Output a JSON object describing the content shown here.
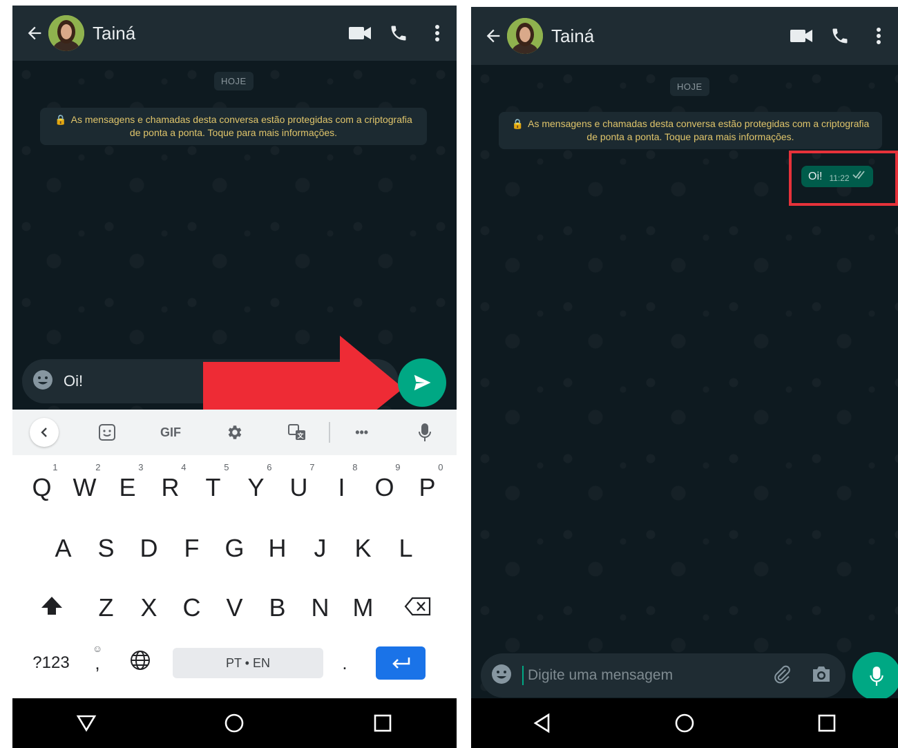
{
  "contact_name": "Tainá",
  "date_chip": "HOJE",
  "encryption_notice": "As mensagens e chamadas desta conversa estão protegidas com a criptografia de ponta a ponta. Toque para mais informações.",
  "left": {
    "typed_message": "Oi!",
    "keyboard": {
      "toolbar_gif": "GIF",
      "toolbar_more": "•••",
      "row1": [
        {
          "key": "Q",
          "num": "1"
        },
        {
          "key": "W",
          "num": "2"
        },
        {
          "key": "E",
          "num": "3"
        },
        {
          "key": "R",
          "num": "4"
        },
        {
          "key": "T",
          "num": "5"
        },
        {
          "key": "Y",
          "num": "6"
        },
        {
          "key": "U",
          "num": "7"
        },
        {
          "key": "I",
          "num": "8"
        },
        {
          "key": "O",
          "num": "9"
        },
        {
          "key": "P",
          "num": "0"
        }
      ],
      "row2": [
        "A",
        "S",
        "D",
        "F",
        "G",
        "H",
        "J",
        "K",
        "L"
      ],
      "row3": [
        "Z",
        "X",
        "C",
        "V",
        "B",
        "N",
        "M"
      ],
      "symbols_key": "?123",
      "comma_key": ",",
      "period_key": ".",
      "space_label": "PT • EN"
    }
  },
  "right": {
    "sent_message": {
      "text": "Oi!",
      "time": "11:22"
    },
    "input_placeholder": "Digite uma mensagem"
  },
  "colors": {
    "header": "#1f2c33",
    "chat_bg": "#0e1a20",
    "accent_green": "#00a884",
    "outgoing_bubble": "#005c4b",
    "arrow_red": "#ee2b35",
    "highlight_red": "#e6323a",
    "notice_text": "#e0c56b",
    "enter_key_blue": "#1a73e8"
  },
  "icons": [
    "back-arrow-icon",
    "video-call-icon",
    "voice-call-icon",
    "more-vert-icon",
    "lock-icon",
    "emoji-icon",
    "send-icon",
    "attach-icon",
    "camera-icon",
    "mic-icon",
    "nav-back-icon",
    "nav-home-icon",
    "nav-recents-icon"
  ]
}
